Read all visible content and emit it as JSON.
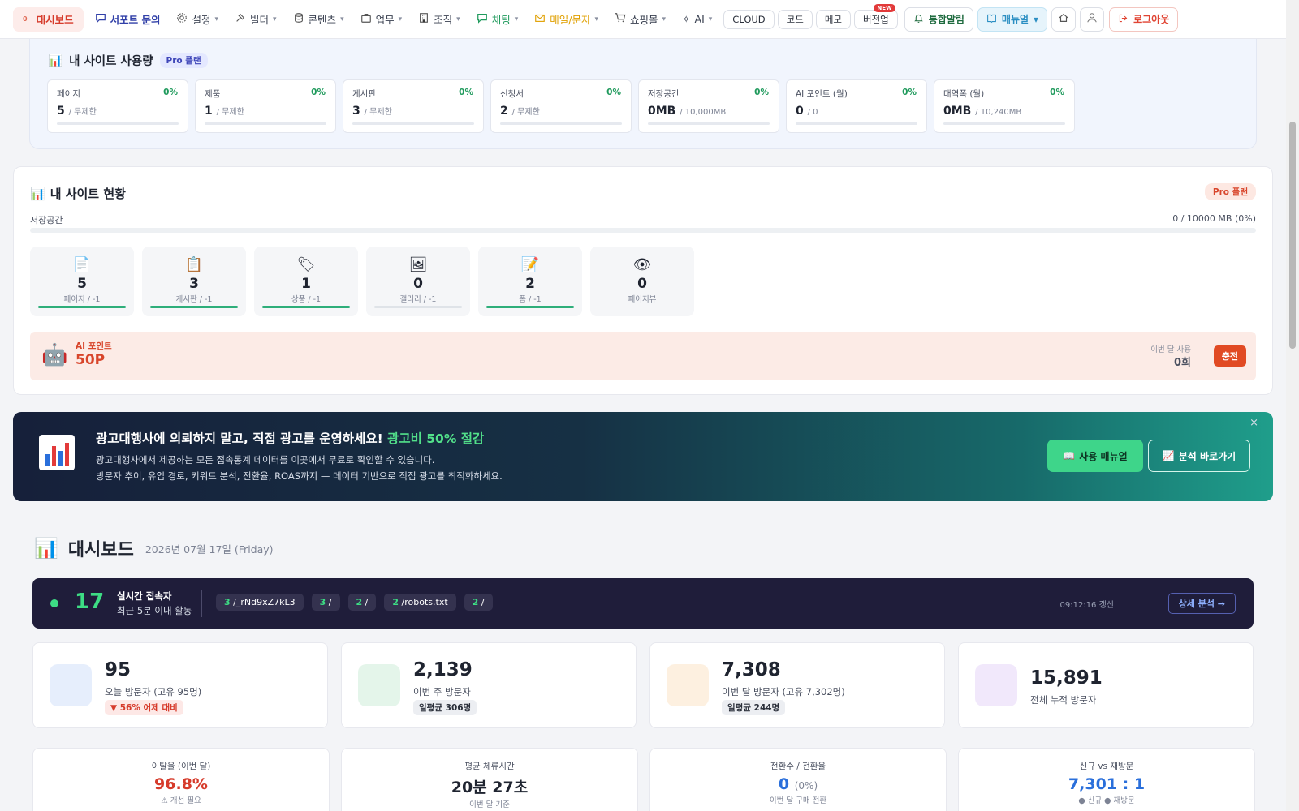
{
  "nav": {
    "dashboard_label": "대시보드",
    "dashboard_mini": "0",
    "support_label": "서포트 문의",
    "settings_label": "설정",
    "builder_label": "빌더",
    "content_label": "콘텐츠",
    "work_label": "업무",
    "org_label": "조직",
    "chat_label": "채팅",
    "mail_label": "메일/문자",
    "shop_label": "쇼핑몰",
    "ai_label": "AI",
    "cloud_label": "CLOUD",
    "code_label": "코드",
    "memo_label": "메모",
    "version_label": "버전업",
    "version_badge": "NEW",
    "alert_label": "통합알림",
    "manual_label": "매뉴얼",
    "logout_label": "로그아웃"
  },
  "usage": {
    "title": "내 사이트 사용량",
    "plan": "Pro 플랜",
    "items": [
      {
        "label": "페이지",
        "pct": "0%",
        "value": "5",
        "limit": "/ 무제한"
      },
      {
        "label": "제품",
        "pct": "0%",
        "value": "1",
        "limit": "/ 무제한"
      },
      {
        "label": "게시판",
        "pct": "0%",
        "value": "3",
        "limit": "/ 무제한"
      },
      {
        "label": "신청서",
        "pct": "0%",
        "value": "2",
        "limit": "/ 무제한"
      },
      {
        "label": "저장공간",
        "pct": "0%",
        "value": "0MB",
        "limit": "/ 10,000MB"
      },
      {
        "label": "AI 포인트 (월)",
        "pct": "0%",
        "value": "0",
        "limit": "/ 0"
      },
      {
        "label": "대역폭 (월)",
        "pct": "0%",
        "value": "0MB",
        "limit": "/ 10,240MB"
      }
    ]
  },
  "status": {
    "title": "내 사이트 현황",
    "plan": "Pro 플랜",
    "storage_label": "저장공간",
    "storage_value": "0 / 10000 MB (0%)",
    "stats": [
      {
        "icon": "📄",
        "value": "5",
        "caption": "페이지 / -1",
        "bar": "green"
      },
      {
        "icon": "📋",
        "value": "3",
        "caption": "게시판 / -1",
        "bar": "green"
      },
      {
        "icon": "🏷",
        "value": "1",
        "caption": "상품 / -1",
        "bar": "green"
      },
      {
        "icon": "🖼",
        "value": "0",
        "caption": "갤러리 / -1",
        "bar": "gray"
      },
      {
        "icon": "📝",
        "value": "2",
        "caption": "폼 / -1",
        "bar": "green"
      },
      {
        "icon": "👁",
        "value": "0",
        "caption": "페이지뷰",
        "bar": "none"
      }
    ],
    "ai_label": "AI 포인트",
    "ai_value": "50P",
    "used_label": "이번 달 사용",
    "used_value": "0회",
    "charge_label": "충전"
  },
  "banner": {
    "title": "광고대행사에 의뢰하지 말고, 직접 광고를 운영하세요!",
    "highlight": "광고비 50% 절감",
    "desc1": "광고대행사에서 제공하는 모든 접속통계 데이터를 이곳에서 무료로 확인할 수 있습니다.",
    "desc2": "방문자 추이, 유입 경로, 키워드 분석, 전환율, ROAS까지 — 데이터 기반으로 직접 광고를 최적화하세요.",
    "btn_manual": "사용 매뉴얼",
    "btn_analysis": "분석 바로가기",
    "close": "×"
  },
  "dashboard": {
    "title": "대시보드",
    "date": "2026년 07월 17일 (Friday)"
  },
  "realtime": {
    "count": "17",
    "label": "실시간 접속자",
    "sub": "최근 5분 이내 활동",
    "chips": [
      {
        "n": "3",
        "path": "/_rNd9xZ7kL3"
      },
      {
        "n": "3",
        "path": "/"
      },
      {
        "n": "2",
        "path": "/"
      },
      {
        "n": "2",
        "path": "/robots.txt"
      },
      {
        "n": "2",
        "path": "/"
      }
    ],
    "updated": "09:12:16 갱신",
    "detail_btn": "상세 분석 →"
  },
  "kpis": [
    {
      "value": "95",
      "label": "오늘 방문자 (고유 95명)",
      "tag": "▼ 56% 어제 대비",
      "tag_style": "red",
      "color": "#e6eefc"
    },
    {
      "value": "2,139",
      "label": "이번 주 방문자",
      "tag": "일평균 306명",
      "tag_style": "gray",
      "color": "#e4f5ea"
    },
    {
      "value": "7,308",
      "label": "이번 달 방문자 (고유 7,302명)",
      "tag": "일평균 244명",
      "tag_style": "gray",
      "color": "#fdf0e0"
    },
    {
      "value": "15,891",
      "label": "전체 누적 방문자",
      "tag": "",
      "tag_style": "none",
      "color": "#f1e8fb"
    }
  ],
  "metrics": [
    {
      "label": "이탈율 (이번 달)",
      "value": "96.8%",
      "extra": "",
      "sub": "⚠ 개선 필요",
      "color": "#d63b2b"
    },
    {
      "label": "평균 체류시간",
      "value": "20분 27초",
      "extra": "",
      "sub": "이번 달 기준",
      "color": "#1f2430"
    },
    {
      "label": "전환수 / 전환율",
      "value": "0",
      "extra": "(0%)",
      "sub": "이번 달 구매 전환",
      "color": "#2a6fdb"
    },
    {
      "label": "신규 vs 재방문",
      "value": "7,301 : 1",
      "extra": "",
      "sub": "● 신규  ● 재방문",
      "color": "#2a6fdb"
    }
  ]
}
